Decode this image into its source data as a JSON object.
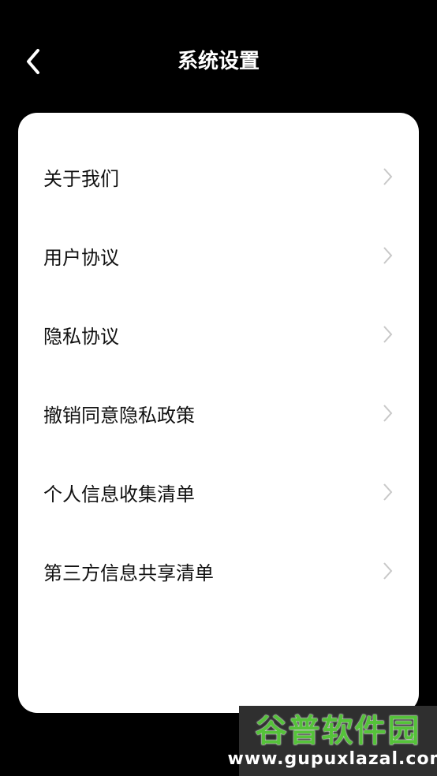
{
  "header": {
    "title": "系统设置"
  },
  "settings": {
    "items": [
      {
        "label": "关于我们"
      },
      {
        "label": "用户协议"
      },
      {
        "label": "隐私协议"
      },
      {
        "label": "撤销同意隐私政策"
      },
      {
        "label": "个人信息收集清单"
      },
      {
        "label": "第三方信息共享清单"
      }
    ]
  },
  "watermark": {
    "title": "谷普软件园",
    "url": "www.gupuxlazal.com"
  },
  "colors": {
    "background": "#000000",
    "card": "#ffffff",
    "text": "#111111",
    "chevron": "#c8c8c8",
    "watermark_green": "#55c23a"
  },
  "icons": {
    "back": "chevron-left-icon",
    "row": "chevron-right-icon"
  }
}
